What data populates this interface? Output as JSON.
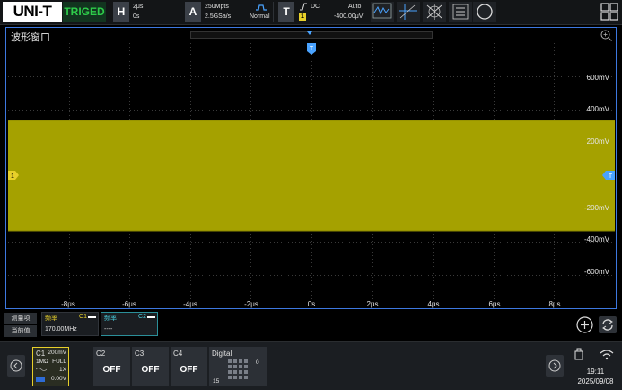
{
  "topbar": {
    "brand": "UNI-T",
    "trigger_status": "TRIGED",
    "horizontal": {
      "key": "H",
      "timebase": "2μs",
      "position": "0s"
    },
    "acquire": {
      "key": "A",
      "memory_depth": "250Mpts",
      "sample_rate": "2.5GSa/s",
      "mode": "Normal"
    },
    "trigger": {
      "key": "T",
      "coupling": "DC",
      "sweep": "Auto",
      "source": "1",
      "level": "-400.00μV"
    }
  },
  "wave_window": {
    "title": "波形窗口",
    "trigger_marker": "T",
    "channel_marker": "1",
    "y_labels": [
      "600mV",
      "400mV",
      "200mV",
      "",
      "-200mV",
      "-400mV",
      "-600mV"
    ],
    "x_labels": [
      "-8μs",
      "-6μs",
      "-4μs",
      "-2μs",
      "0s",
      "2μs",
      "4μs",
      "6μs",
      "8μs"
    ],
    "colors": {
      "trace": "#a5a100",
      "grid": "#3a3a3a",
      "border": "#3d78e0"
    }
  },
  "measure": {
    "item_label": "测量项",
    "value_label": "当前值",
    "boxes": [
      {
        "name": "频率",
        "channel": "C1",
        "value": "170.00MHz",
        "ch_color": "#e8d02a",
        "selected": false
      },
      {
        "name": "频率",
        "channel": "C2",
        "value": "----",
        "ch_color": "#4ad0e0",
        "selected": true
      }
    ]
  },
  "bottom": {
    "channels": [
      {
        "name": "C1",
        "active": true,
        "scale": "200mV",
        "impedance": "1MΩ",
        "bandwidth": "FULL",
        "probe": "1X",
        "offset": "0.00V"
      },
      {
        "name": "C2",
        "state": "OFF"
      },
      {
        "name": "C3",
        "state": "OFF"
      },
      {
        "name": "C4",
        "state": "OFF"
      }
    ],
    "digital": {
      "name": "Digital",
      "top_value": "0",
      "bottom_value": "15"
    },
    "time": "19:11",
    "date": "2025/09/08"
  }
}
